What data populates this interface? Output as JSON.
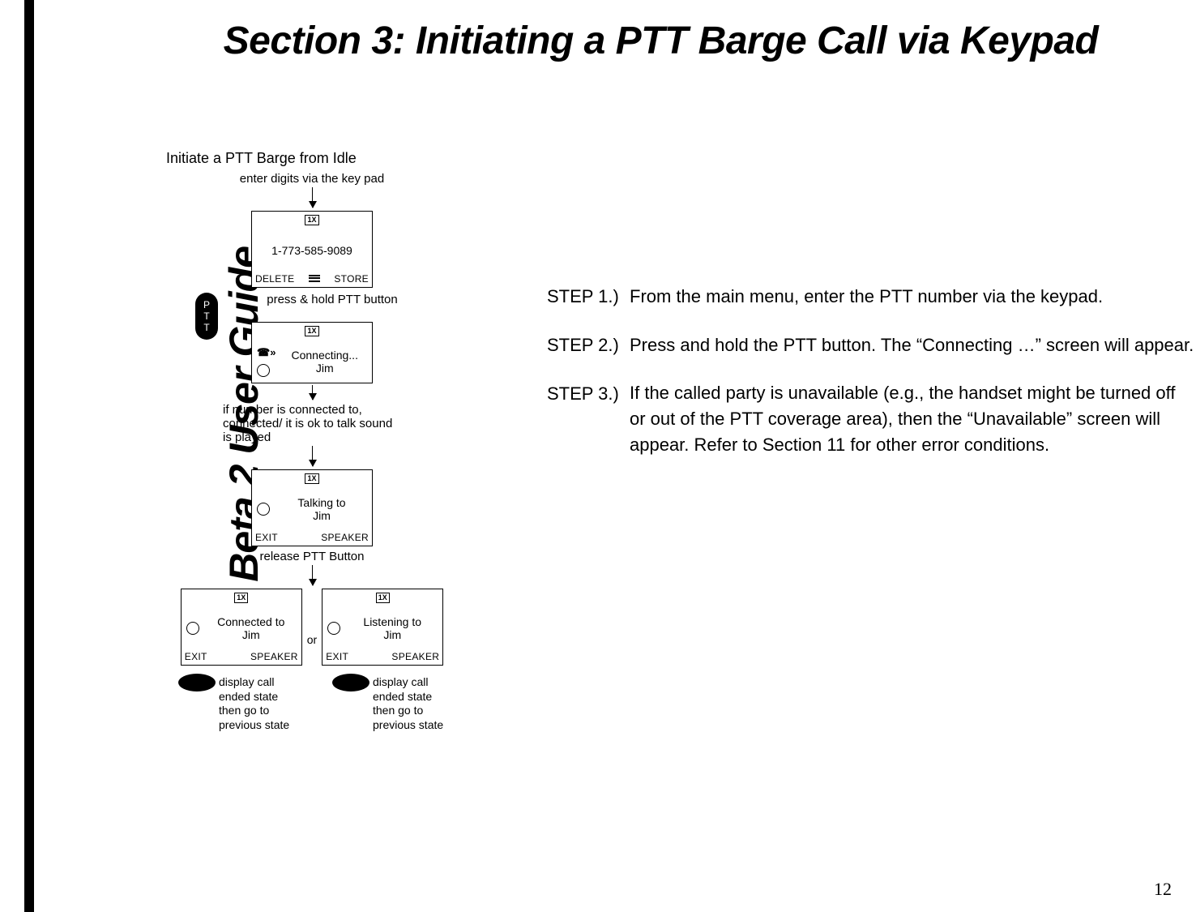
{
  "sidebar": {
    "title": "PTT Beta 2 User Guide"
  },
  "page_number": "12",
  "title": "Section 3: Initiating a PTT Barge Call via Keypad",
  "steps": [
    {
      "label": "STEP 1.)",
      "body": "From the main menu, enter the PTT number via the keypad."
    },
    {
      "label": "STEP 2.)",
      "body": "Press and hold the PTT button.  The “Connecting …” screen will appear."
    },
    {
      "label": "STEP 3.)",
      "body": "If the called party is unavailable (e.g., the handset might be turned off or out of the PTT coverage area), then the “Unavailable” screen will appear. Refer to Section 11 for other error conditions."
    }
  ],
  "diagram": {
    "title": "Initiate a PTT Barge from Idle",
    "enter_digits": "enter digits via the key pad",
    "signal_badge": "1X",
    "screen1": {
      "number": "1-773-585-9089",
      "soft_left": "DELETE",
      "soft_right": "STORE"
    },
    "ptt_label": "P\nT\nT",
    "press_hold": "press & hold PTT button",
    "screen2": {
      "line1": "Connecting...",
      "line2": "Jim"
    },
    "if_connected": "if number is connected to, connected/ it is ok to talk sound is played",
    "screen3": {
      "line1": "Talking to",
      "line2": "Jim",
      "soft_left": "EXIT",
      "soft_right": "SPEAKER"
    },
    "release": "release PTT Button",
    "or": "or",
    "screen4a": {
      "line1": "Connected to",
      "line2": "Jim",
      "soft_left": "EXIT",
      "soft_right": "SPEAKER"
    },
    "screen4b": {
      "line1": "Listening to",
      "line2": "Jim",
      "soft_left": "EXIT",
      "soft_right": "SPEAKER"
    },
    "end_text": "display call ended state then go to previous state"
  }
}
